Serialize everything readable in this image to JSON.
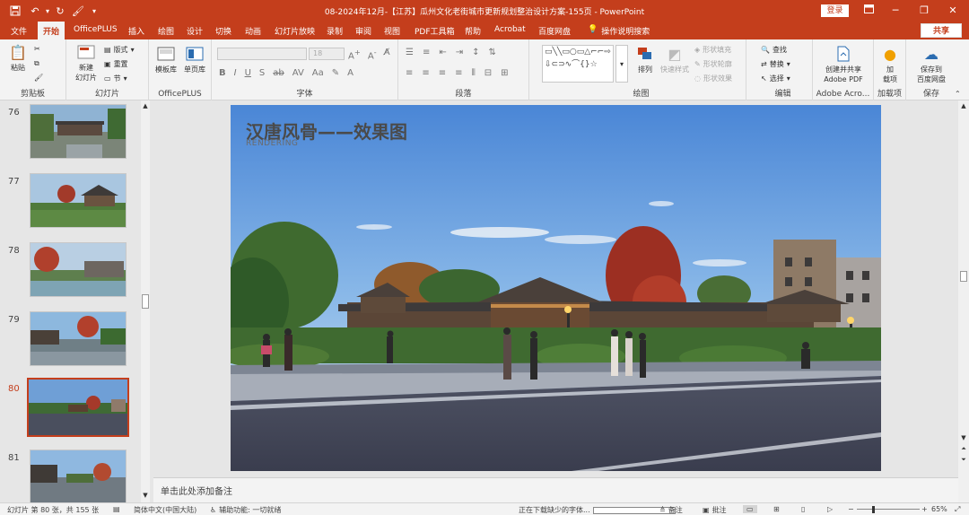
{
  "titlebar": {
    "title": "08-2024年12月-【江苏】瓜州文化老街城市更新规划整治设计方案-155页 - PowerPoint",
    "login": "登录",
    "icons": [
      "save-icon",
      "undo-icon",
      "redo-icon",
      "format-painter-icon",
      "customize-qat-icon"
    ],
    "window_controls": [
      "ribbon-display-icon",
      "minimize-icon",
      "restore-icon",
      "close-icon"
    ]
  },
  "tabs": {
    "items": [
      "文件",
      "开始",
      "OfficePLUS",
      "插入",
      "绘图",
      "设计",
      "切换",
      "动画",
      "幻灯片放映",
      "录制",
      "审阅",
      "视图",
      "PDF工具箱",
      "帮助",
      "Acrobat",
      "百度网盘"
    ],
    "active": "开始",
    "search": "操作说明搜索",
    "share": "共享"
  },
  "ribbon": {
    "clipboard": {
      "paste": "粘贴",
      "label": "剪贴板"
    },
    "slides": {
      "new_line1": "新建",
      "new_line2": "幻灯片",
      "layout": "版式",
      "reset": "重置",
      "section": "节",
      "label": "幻灯片"
    },
    "officeplus": {
      "template": "模板库",
      "single": "单页库",
      "label": "OfficePLUS"
    },
    "font": {
      "size": "18",
      "label": "字体"
    },
    "paragraph": {
      "label": "段落"
    },
    "drawing": {
      "arrange": "排列",
      "quick_styles": "快速样式",
      "fill": "形状填充",
      "outline": "形状轮廓",
      "effect": "形状效果",
      "label": "绘图",
      "shapes_preview": "▭╲╲▭○▭△⌐⌐⇨⇩⊂⊃∿⌒{}☆"
    },
    "editing": {
      "find": "查找",
      "replace": "替换",
      "select": "选择",
      "label": "编辑"
    },
    "acrobat": {
      "line1": "创建并共享",
      "line2": "Adobe PDF",
      "label": "Adobe Acro..."
    },
    "addins": {
      "line1": "加",
      "line2": "载项",
      "label": "加载项"
    },
    "save": {
      "line1": "保存到",
      "line2": "百度网盘",
      "label": "保存"
    }
  },
  "thumbnails": {
    "items": [
      {
        "num": "76"
      },
      {
        "num": "77"
      },
      {
        "num": "78"
      },
      {
        "num": "79"
      },
      {
        "num": "80",
        "selected": true
      },
      {
        "num": "81"
      }
    ]
  },
  "slide": {
    "title": "汉唐风骨——效果图",
    "subtitle": "RENDERING"
  },
  "notes": {
    "placeholder": "单击此处添加备注"
  },
  "status": {
    "slide_info": "幻灯片 第 80 张，共 155 张",
    "language": "简体中文(中国大陆)",
    "accessibility": "辅助功能: 一切就绪",
    "font_download": "正在下载缺少的字体...",
    "notes": "备注",
    "comments": "批注",
    "zoom": "65%"
  },
  "colors": {
    "accent": "#c43e1c"
  }
}
